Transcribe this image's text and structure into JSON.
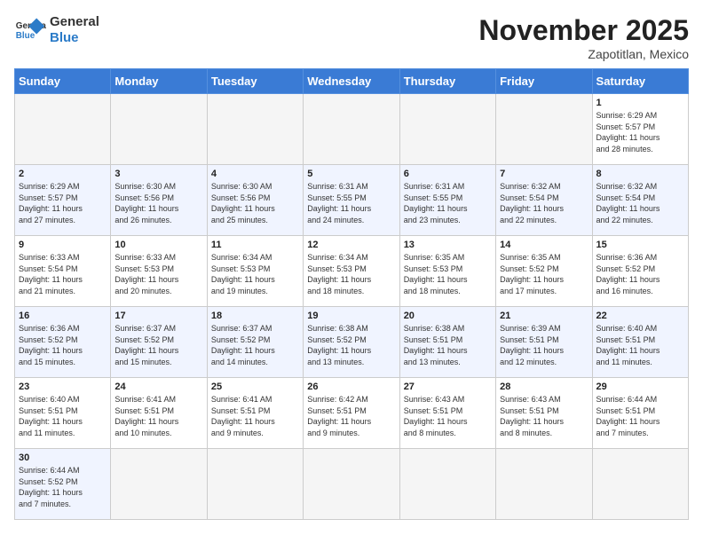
{
  "header": {
    "logo_text_general": "General",
    "logo_text_blue": "Blue",
    "month_year": "November 2025",
    "location": "Zapotitlan, Mexico"
  },
  "days_of_week": [
    "Sunday",
    "Monday",
    "Tuesday",
    "Wednesday",
    "Thursday",
    "Friday",
    "Saturday"
  ],
  "weeks": [
    [
      {
        "day": "",
        "content": ""
      },
      {
        "day": "",
        "content": ""
      },
      {
        "day": "",
        "content": ""
      },
      {
        "day": "",
        "content": ""
      },
      {
        "day": "",
        "content": ""
      },
      {
        "day": "",
        "content": ""
      },
      {
        "day": "1",
        "content": "Sunrise: 6:29 AM\nSunset: 5:57 PM\nDaylight: 11 hours\nand 28 minutes."
      }
    ],
    [
      {
        "day": "2",
        "content": "Sunrise: 6:29 AM\nSunset: 5:57 PM\nDaylight: 11 hours\nand 27 minutes."
      },
      {
        "day": "3",
        "content": "Sunrise: 6:30 AM\nSunset: 5:56 PM\nDaylight: 11 hours\nand 26 minutes."
      },
      {
        "day": "4",
        "content": "Sunrise: 6:30 AM\nSunset: 5:56 PM\nDaylight: 11 hours\nand 25 minutes."
      },
      {
        "day": "5",
        "content": "Sunrise: 6:31 AM\nSunset: 5:55 PM\nDaylight: 11 hours\nand 24 minutes."
      },
      {
        "day": "6",
        "content": "Sunrise: 6:31 AM\nSunset: 5:55 PM\nDaylight: 11 hours\nand 23 minutes."
      },
      {
        "day": "7",
        "content": "Sunrise: 6:32 AM\nSunset: 5:54 PM\nDaylight: 11 hours\nand 22 minutes."
      },
      {
        "day": "8",
        "content": "Sunrise: 6:32 AM\nSunset: 5:54 PM\nDaylight: 11 hours\nand 22 minutes."
      }
    ],
    [
      {
        "day": "9",
        "content": "Sunrise: 6:33 AM\nSunset: 5:54 PM\nDaylight: 11 hours\nand 21 minutes."
      },
      {
        "day": "10",
        "content": "Sunrise: 6:33 AM\nSunset: 5:53 PM\nDaylight: 11 hours\nand 20 minutes."
      },
      {
        "day": "11",
        "content": "Sunrise: 6:34 AM\nSunset: 5:53 PM\nDaylight: 11 hours\nand 19 minutes."
      },
      {
        "day": "12",
        "content": "Sunrise: 6:34 AM\nSunset: 5:53 PM\nDaylight: 11 hours\nand 18 minutes."
      },
      {
        "day": "13",
        "content": "Sunrise: 6:35 AM\nSunset: 5:53 PM\nDaylight: 11 hours\nand 18 minutes."
      },
      {
        "day": "14",
        "content": "Sunrise: 6:35 AM\nSunset: 5:52 PM\nDaylight: 11 hours\nand 17 minutes."
      },
      {
        "day": "15",
        "content": "Sunrise: 6:36 AM\nSunset: 5:52 PM\nDaylight: 11 hours\nand 16 minutes."
      }
    ],
    [
      {
        "day": "16",
        "content": "Sunrise: 6:36 AM\nSunset: 5:52 PM\nDaylight: 11 hours\nand 15 minutes."
      },
      {
        "day": "17",
        "content": "Sunrise: 6:37 AM\nSunset: 5:52 PM\nDaylight: 11 hours\nand 15 minutes."
      },
      {
        "day": "18",
        "content": "Sunrise: 6:37 AM\nSunset: 5:52 PM\nDaylight: 11 hours\nand 14 minutes."
      },
      {
        "day": "19",
        "content": "Sunrise: 6:38 AM\nSunset: 5:52 PM\nDaylight: 11 hours\nand 13 minutes."
      },
      {
        "day": "20",
        "content": "Sunrise: 6:38 AM\nSunset: 5:51 PM\nDaylight: 11 hours\nand 13 minutes."
      },
      {
        "day": "21",
        "content": "Sunrise: 6:39 AM\nSunset: 5:51 PM\nDaylight: 11 hours\nand 12 minutes."
      },
      {
        "day": "22",
        "content": "Sunrise: 6:40 AM\nSunset: 5:51 PM\nDaylight: 11 hours\nand 11 minutes."
      }
    ],
    [
      {
        "day": "23",
        "content": "Sunrise: 6:40 AM\nSunset: 5:51 PM\nDaylight: 11 hours\nand 11 minutes."
      },
      {
        "day": "24",
        "content": "Sunrise: 6:41 AM\nSunset: 5:51 PM\nDaylight: 11 hours\nand 10 minutes."
      },
      {
        "day": "25",
        "content": "Sunrise: 6:41 AM\nSunset: 5:51 PM\nDaylight: 11 hours\nand 9 minutes."
      },
      {
        "day": "26",
        "content": "Sunrise: 6:42 AM\nSunset: 5:51 PM\nDaylight: 11 hours\nand 9 minutes."
      },
      {
        "day": "27",
        "content": "Sunrise: 6:43 AM\nSunset: 5:51 PM\nDaylight: 11 hours\nand 8 minutes."
      },
      {
        "day": "28",
        "content": "Sunrise: 6:43 AM\nSunset: 5:51 PM\nDaylight: 11 hours\nand 8 minutes."
      },
      {
        "day": "29",
        "content": "Sunrise: 6:44 AM\nSunset: 5:51 PM\nDaylight: 11 hours\nand 7 minutes."
      }
    ],
    [
      {
        "day": "30",
        "content": "Sunrise: 6:44 AM\nSunset: 5:52 PM\nDaylight: 11 hours\nand 7 minutes."
      },
      {
        "day": "",
        "content": ""
      },
      {
        "day": "",
        "content": ""
      },
      {
        "day": "",
        "content": ""
      },
      {
        "day": "",
        "content": ""
      },
      {
        "day": "",
        "content": ""
      },
      {
        "day": "",
        "content": ""
      }
    ]
  ]
}
